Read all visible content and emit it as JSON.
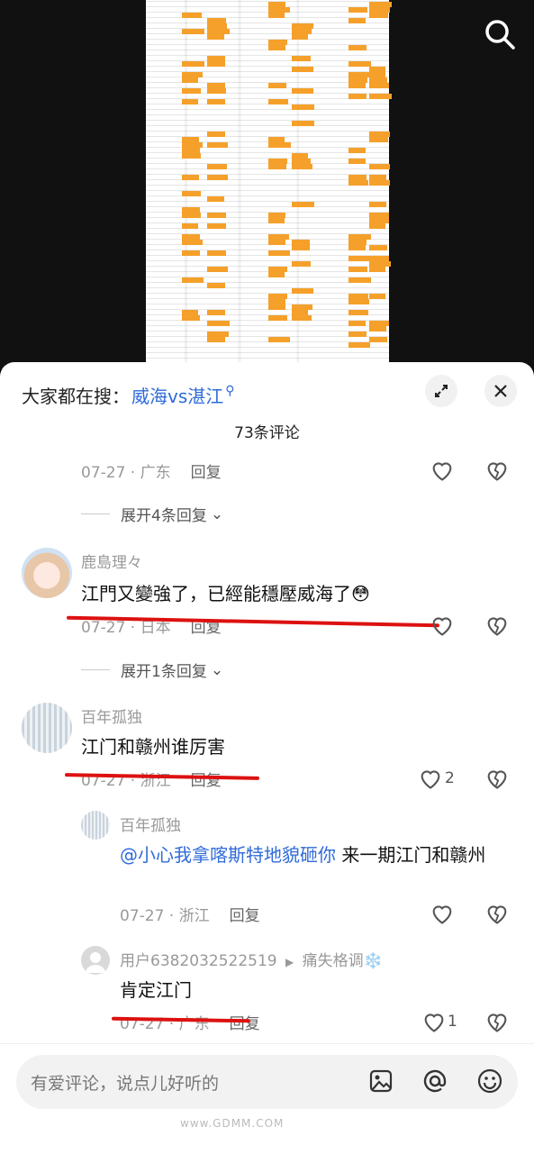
{
  "search_bar": {
    "prefix": "大家都在搜：",
    "term": "威海vs湛江",
    "term_icon": "search-small-icon"
  },
  "comments_count": "73条评论",
  "thread0": {
    "date_location": "07-27 · 广东",
    "reply_label": "回复",
    "expand_label": "展开4条回复"
  },
  "comment1": {
    "author": "鹿島理々",
    "text": "江門又變強了，已經能穩壓威海了😳",
    "date_location": "07-27 · 日本",
    "reply_label": "回复",
    "expand_label": "展开1条回复"
  },
  "comment2": {
    "author": "百年孤独",
    "text": "江门和赣州谁厉害",
    "date_location": "07-27 · 浙江",
    "reply_label": "回复",
    "likes": "2",
    "replies": [
      {
        "author": "百年孤独",
        "mention": "@小心我拿喀斯特地貌砸你",
        "text": " 来一期江门和赣州",
        "date_location": "07-27 · 浙江",
        "reply_label": "回复"
      },
      {
        "author": "用户6382032522519",
        "reply_to": "痛失格调❄️",
        "text": "肯定江门",
        "date_location": "07-27 · 广东",
        "reply_label": "回复",
        "likes": "1"
      }
    ]
  },
  "input": {
    "placeholder": "有爱评论，说点儿好听的"
  },
  "watermark": "www.GDMM.COM",
  "colors": {
    "link_blue": "#2f6bd8",
    "highlight_orange": "#f5a02a",
    "annotation_red": "#d11111"
  }
}
